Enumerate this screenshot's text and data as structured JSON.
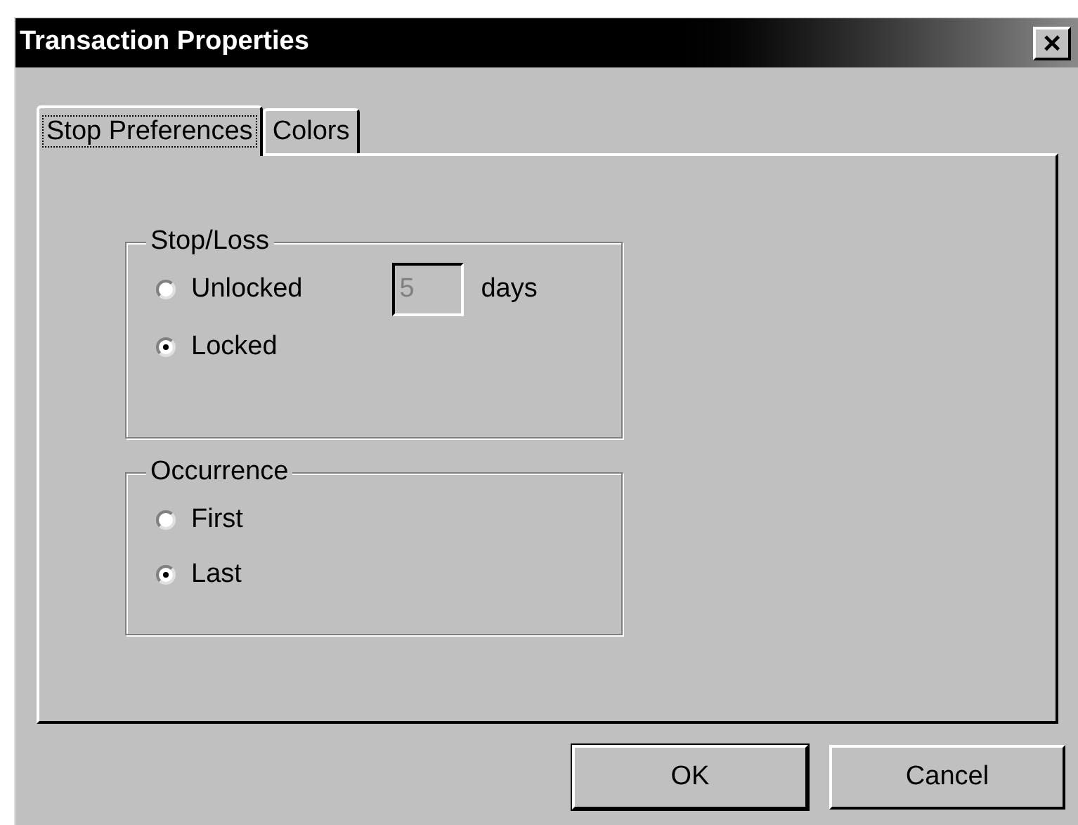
{
  "window": {
    "title": "Transaction Properties",
    "close_glyph": "×"
  },
  "tabs": [
    {
      "label": "Stop Preferences",
      "selected": true,
      "focused": true
    },
    {
      "label": "Colors",
      "selected": false,
      "focused": false
    }
  ],
  "groups": [
    {
      "title": "Stop/Loss",
      "options": [
        {
          "label": "Unlocked",
          "selected": false
        },
        {
          "label": "Locked",
          "selected": true
        }
      ],
      "field": {
        "value": "5",
        "disabled": true,
        "unit": "days"
      }
    },
    {
      "title": "Occurrence",
      "options": [
        {
          "label": "First",
          "selected": false
        },
        {
          "label": "Last",
          "selected": true
        }
      ]
    }
  ],
  "buttons": [
    {
      "label": "OK",
      "default": true
    },
    {
      "label": "Cancel",
      "default": false
    }
  ]
}
